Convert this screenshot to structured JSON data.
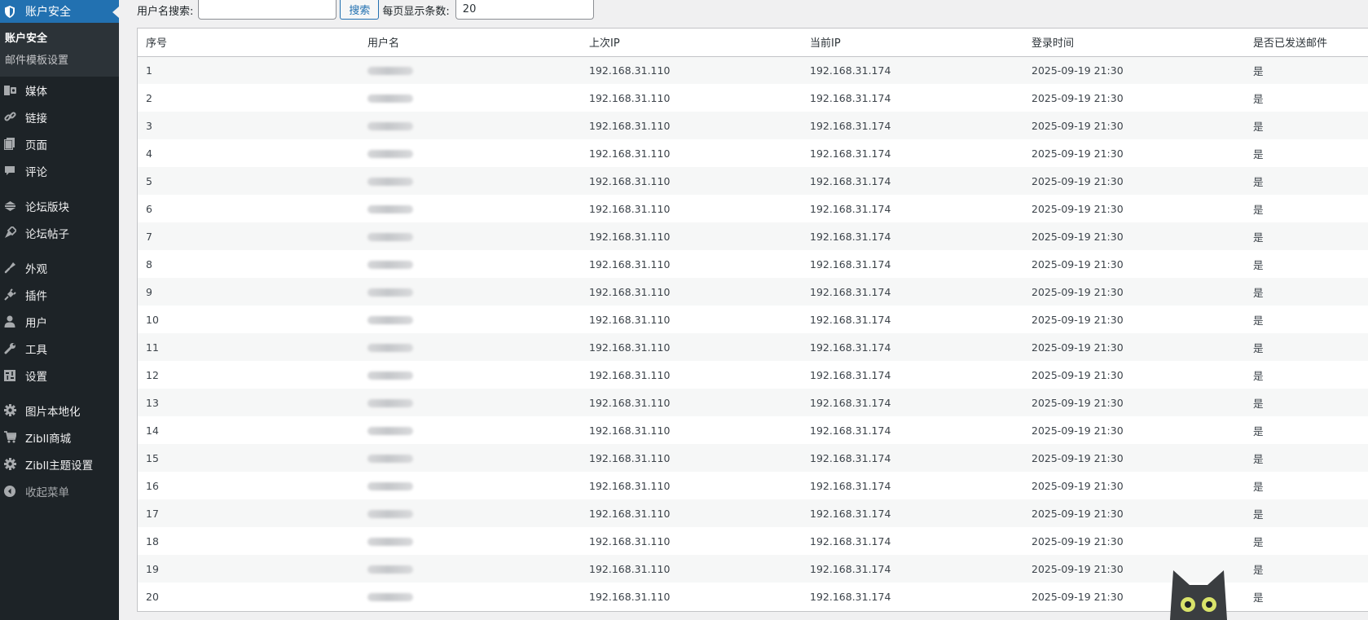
{
  "sidebar": {
    "current": {
      "label": "账户安全",
      "icon": "shield-icon"
    },
    "submenu": [
      {
        "label": "账户安全",
        "active": true
      },
      {
        "label": "邮件模板设置",
        "active": false
      }
    ],
    "items": [
      {
        "label": "媒体",
        "icon": "media-icon"
      },
      {
        "label": "链接",
        "icon": "link-icon"
      },
      {
        "label": "页面",
        "icon": "page-icon"
      },
      {
        "label": "评论",
        "icon": "comment-icon"
      },
      {
        "label": "论坛版块",
        "icon": "forum-icon"
      },
      {
        "label": "论坛帖子",
        "icon": "forum-post-icon"
      },
      {
        "label": "外观",
        "icon": "appearance-icon"
      },
      {
        "label": "插件",
        "icon": "plugin-icon"
      },
      {
        "label": "用户",
        "icon": "user-icon"
      },
      {
        "label": "工具",
        "icon": "wrench-icon"
      },
      {
        "label": "设置",
        "icon": "settings-icon"
      },
      {
        "label": "图片本地化",
        "icon": "gear-icon"
      },
      {
        "label": "Zibll商城",
        "icon": "cart-icon"
      },
      {
        "label": "Zibll主题设置",
        "icon": "gear-icon"
      },
      {
        "label": "收起菜单",
        "icon": "collapse-icon"
      }
    ]
  },
  "search": {
    "label": "用户名搜索:",
    "value": "",
    "button_label": "搜索",
    "perpage_label": "每页显示条数:",
    "perpage_value": "20"
  },
  "table": {
    "headers": [
      "序号",
      "用户名",
      "上次IP",
      "当前IP",
      "登录时间",
      "是否已发送邮件"
    ],
    "rows": [
      {
        "no": "1",
        "last_ip": "192.168.31.110",
        "current_ip": "192.168.31.174",
        "login_time": "2025-09-19 21:30",
        "email_sent": "是"
      },
      {
        "no": "2",
        "last_ip": "192.168.31.110",
        "current_ip": "192.168.31.174",
        "login_time": "2025-09-19 21:30",
        "email_sent": "是"
      },
      {
        "no": "3",
        "last_ip": "192.168.31.110",
        "current_ip": "192.168.31.174",
        "login_time": "2025-09-19 21:30",
        "email_sent": "是"
      },
      {
        "no": "4",
        "last_ip": "192.168.31.110",
        "current_ip": "192.168.31.174",
        "login_time": "2025-09-19 21:30",
        "email_sent": "是"
      },
      {
        "no": "5",
        "last_ip": "192.168.31.110",
        "current_ip": "192.168.31.174",
        "login_time": "2025-09-19 21:30",
        "email_sent": "是"
      },
      {
        "no": "6",
        "last_ip": "192.168.31.110",
        "current_ip": "192.168.31.174",
        "login_time": "2025-09-19 21:30",
        "email_sent": "是"
      },
      {
        "no": "7",
        "last_ip": "192.168.31.110",
        "current_ip": "192.168.31.174",
        "login_time": "2025-09-19 21:30",
        "email_sent": "是"
      },
      {
        "no": "8",
        "last_ip": "192.168.31.110",
        "current_ip": "192.168.31.174",
        "login_time": "2025-09-19 21:30",
        "email_sent": "是"
      },
      {
        "no": "9",
        "last_ip": "192.168.31.110",
        "current_ip": "192.168.31.174",
        "login_time": "2025-09-19 21:30",
        "email_sent": "是"
      },
      {
        "no": "10",
        "last_ip": "192.168.31.110",
        "current_ip": "192.168.31.174",
        "login_time": "2025-09-19 21:30",
        "email_sent": "是"
      },
      {
        "no": "11",
        "last_ip": "192.168.31.110",
        "current_ip": "192.168.31.174",
        "login_time": "2025-09-19 21:30",
        "email_sent": "是"
      },
      {
        "no": "12",
        "last_ip": "192.168.31.110",
        "current_ip": "192.168.31.174",
        "login_time": "2025-09-19 21:30",
        "email_sent": "是"
      },
      {
        "no": "13",
        "last_ip": "192.168.31.110",
        "current_ip": "192.168.31.174",
        "login_time": "2025-09-19 21:30",
        "email_sent": "是"
      },
      {
        "no": "14",
        "last_ip": "192.168.31.110",
        "current_ip": "192.168.31.174",
        "login_time": "2025-09-19 21:30",
        "email_sent": "是"
      },
      {
        "no": "15",
        "last_ip": "192.168.31.110",
        "current_ip": "192.168.31.174",
        "login_time": "2025-09-19 21:30",
        "email_sent": "是"
      },
      {
        "no": "16",
        "last_ip": "192.168.31.110",
        "current_ip": "192.168.31.174",
        "login_time": "2025-09-19 21:30",
        "email_sent": "是"
      },
      {
        "no": "17",
        "last_ip": "192.168.31.110",
        "current_ip": "192.168.31.174",
        "login_time": "2025-09-19 21:30",
        "email_sent": "是"
      },
      {
        "no": "18",
        "last_ip": "192.168.31.110",
        "current_ip": "192.168.31.174",
        "login_time": "2025-09-19 21:30",
        "email_sent": "是"
      },
      {
        "no": "19",
        "last_ip": "192.168.31.110",
        "current_ip": "192.168.31.174",
        "login_time": "2025-09-19 21:30",
        "email_sent": "是"
      },
      {
        "no": "20",
        "last_ip": "192.168.31.110",
        "current_ip": "192.168.31.174",
        "login_time": "2025-09-19 21:30",
        "email_sent": "是"
      }
    ]
  },
  "colors": {
    "sidebar_bg": "#1d2327",
    "accent": "#2271b1",
    "submenu_bg": "#2c3338"
  }
}
